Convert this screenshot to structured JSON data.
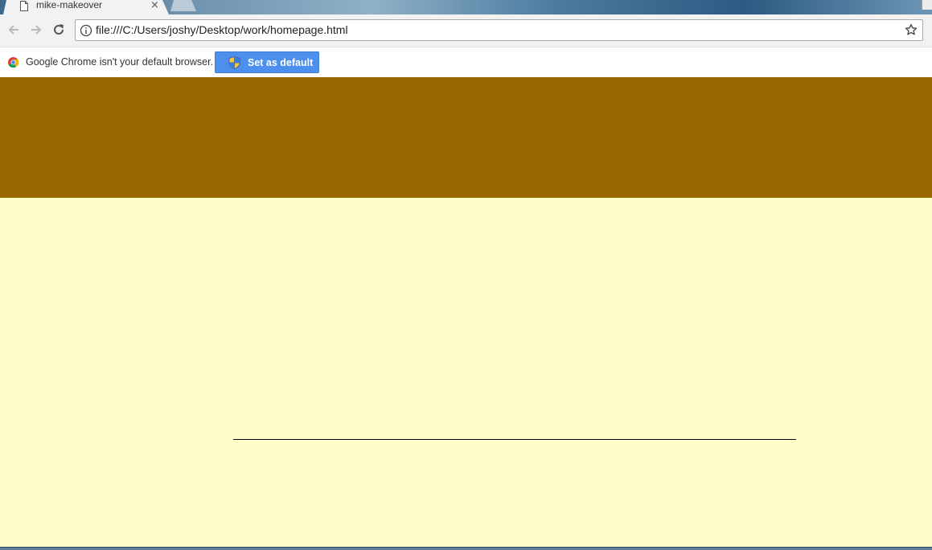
{
  "browser": {
    "tab": {
      "title": "mike-makeover",
      "close_glyph": "×",
      "icon": "page-icon"
    },
    "toolbar": {
      "back_icon": "back-arrow-icon",
      "forward_icon": "forward-arrow-icon",
      "reload_icon": "reload-icon",
      "url": "file:///C:/Users/joshy/Desktop/work/homepage.html",
      "info_icon": "info-icon",
      "bookmark_icon": "star-icon"
    },
    "infobar": {
      "message": "Google Chrome isn't your default browser.",
      "button_label": "Set as default",
      "button_icon": "shield-icon",
      "logo_icon": "chrome-logo-icon"
    }
  },
  "colors": {
    "header_bg": "#9a6600",
    "body_bg": "#fffdc8",
    "button_bg": "#4d8fec"
  }
}
